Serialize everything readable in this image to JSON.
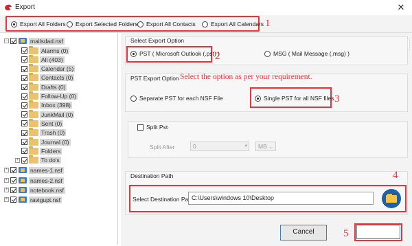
{
  "window": {
    "title": "Export",
    "close_glyph": "✕"
  },
  "export_scope": {
    "options": [
      {
        "label": "Export All Folders",
        "selected": true
      },
      {
        "label": "Export Selected Folders",
        "selected": false
      },
      {
        "label": "Export All Contacts",
        "selected": false
      },
      {
        "label": "Export All Calendars",
        "selected": false
      }
    ]
  },
  "annotations": {
    "step1": "1",
    "step2": "2",
    "step3": "3",
    "step4": "4",
    "step5": "5",
    "hint": "Select the option as per your requirement."
  },
  "tree": {
    "root": "mailsdad.nsf",
    "folders": [
      "Alarms (0)",
      "All (403)",
      "Calendar (5)",
      "Contacts (0)",
      "Drafts (0)",
      "Follow-Up (0)",
      "Inbox (398)",
      "JunkMail (0)",
      "Sent (0)",
      "Trash (0)",
      "Journal (0)",
      "Folders",
      "To do's"
    ],
    "others": [
      "names-1.nsf",
      "names-2.nsf",
      "notebook.nsf",
      "ravigupt.nsf"
    ]
  },
  "export_option": {
    "title": "Select Export Option",
    "pst_label": "PST ( Microsoft Outlook (.pst) )",
    "msg_label": "MSG ( Mail Message (.msg) )",
    "selected": "pst"
  },
  "pst_option": {
    "title": "PST Export Option",
    "separate_label": "Separate PST for each NSF File",
    "single_label": "Single PST for all NSF files",
    "selected": "single"
  },
  "split": {
    "checkbox_label": "Split Pst",
    "after_label": "Split After",
    "value": "0",
    "unit": "MB"
  },
  "destination": {
    "title": "Destination Path",
    "label": "Select Destination Path",
    "value": "C:\\Users\\windows 10\\Desktop"
  },
  "buttons": {
    "cancel": "Cancel",
    "export": ""
  },
  "colors": {
    "accent_red": "#e8333a",
    "accent_blue": "#3c7fb1"
  }
}
